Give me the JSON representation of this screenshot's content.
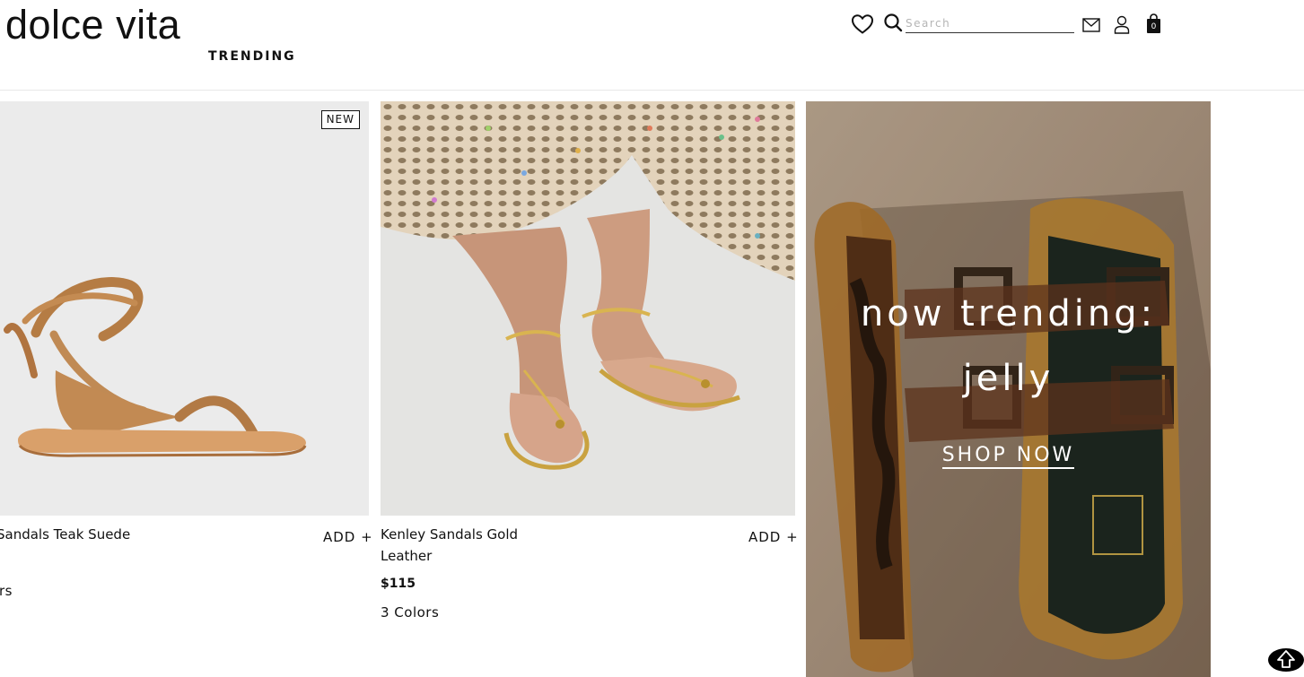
{
  "header": {
    "logo": "dolce vita",
    "nav_trending": "TRENDING",
    "search_placeholder": "Search",
    "cart_count": "0"
  },
  "products": [
    {
      "name_line1": "Sandals Teak Suede",
      "add_label": "ADD +",
      "colors_partial": "rs",
      "badge": "NEW",
      "image_icon": "lace-up-flat-sandal-image"
    },
    {
      "name_line1": "Kenley Sandals Gold",
      "name_line2": "Leather",
      "add_label": "ADD +",
      "price": "$115",
      "colors": "3 Colors",
      "image_icon": "gold-thong-sandals-on-feet-image"
    }
  ],
  "promo": {
    "line1": "now trending:",
    "line2": "jelly",
    "cta": "SHOP NOW"
  },
  "colors": {
    "text": "#111111",
    "product_bg": "#ececec",
    "sandal_tan": "#c08a54",
    "promo_sand": "#b39b82"
  }
}
